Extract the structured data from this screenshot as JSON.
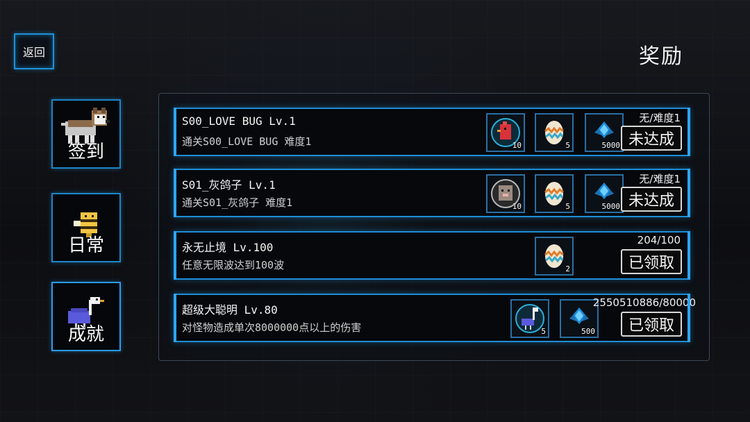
{
  "header": {
    "back_label": "返回",
    "title": "奖励"
  },
  "sidebar": {
    "tabs": [
      {
        "label": "签到",
        "icon": "husky-dog-icon"
      },
      {
        "label": "日常",
        "icon": "bee-icon"
      },
      {
        "label": "成就",
        "icon": "ostrich-icon",
        "active": true
      }
    ]
  },
  "achievements": [
    {
      "title": "S00_LOVE BUG Lv.1",
      "description": "通关S00_LOVE BUG 难度1",
      "progress": "无/难度1",
      "status": "未达成",
      "rewards": [
        {
          "icon": "red-bird-icon",
          "count": "10"
        },
        {
          "icon": "egg-icon",
          "count": "5"
        },
        {
          "icon": "gem-icon",
          "count": "5000"
        }
      ]
    },
    {
      "title": "S01_灰鸽子 Lv.1",
      "description": "通关S01_灰鸽子 难度1",
      "progress": "无/难度1",
      "status": "未达成",
      "rewards": [
        {
          "icon": "mole-icon",
          "count": "10"
        },
        {
          "icon": "egg-icon",
          "count": "5"
        },
        {
          "icon": "gem-icon",
          "count": "5000"
        }
      ]
    },
    {
      "title": "永无止境 Lv.100",
      "description": "任意无限波达到100波",
      "progress": "204/100",
      "status": "已领取",
      "rewards": [
        {
          "icon": "egg-icon",
          "count": "2"
        }
      ]
    },
    {
      "title": "超级大聪明 Lv.80",
      "description": "对怪物造成单次8000000点以上的伤害",
      "progress": "2550510886/80000",
      "status": "已领取",
      "rewards": [
        {
          "icon": "ostrich-icon",
          "count": "5"
        },
        {
          "icon": "gem-icon",
          "count": "500"
        }
      ]
    }
  ]
}
